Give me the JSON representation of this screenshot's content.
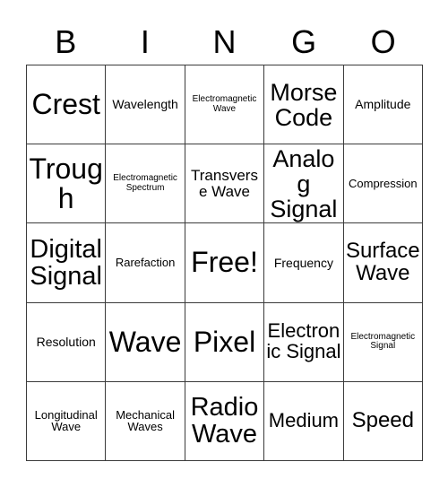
{
  "card": {
    "type": "bingo-card",
    "columns": 5,
    "rows": 5,
    "header": {
      "letters": [
        "B",
        "I",
        "N",
        "G",
        "O"
      ]
    },
    "colors": {
      "background": "#ffffff",
      "border": "#3b3b3b",
      "text": "#000000"
    },
    "cells": [
      {
        "label": "Crest",
        "size": "fs-xxl",
        "free": false
      },
      {
        "label": "Wavelength",
        "size": "fs-xxs",
        "free": false
      },
      {
        "label": "Electromagnetic Wave",
        "size": "fs-mini",
        "free": false
      },
      {
        "label": "Morse Code",
        "size": "fs-lg",
        "free": false
      },
      {
        "label": "Amplitude",
        "size": "fs-xxs",
        "free": false
      },
      {
        "label": "Trough",
        "size": "fs-xxl",
        "free": false
      },
      {
        "label": "Electromagnetic Spectrum",
        "size": "fs-mini",
        "free": false
      },
      {
        "label": "Transverse Wave",
        "size": "fs-xs",
        "free": false
      },
      {
        "label": "Analog Signal",
        "size": "fs-lg",
        "free": false
      },
      {
        "label": "Compression",
        "size": "fs-tiny",
        "free": false
      },
      {
        "label": "Digital Signal",
        "size": "fs-xl",
        "free": false
      },
      {
        "label": "Rarefaction",
        "size": "fs-tiny",
        "free": false
      },
      {
        "label": "Free!",
        "size": "fs-xxl",
        "free": true
      },
      {
        "label": "Frequency",
        "size": "fs-xxs",
        "free": false
      },
      {
        "label": "Surface Wave",
        "size": "fs-md",
        "free": false
      },
      {
        "label": "Resolution",
        "size": "fs-xxs",
        "free": false
      },
      {
        "label": "Wave",
        "size": "fs-xxl",
        "free": false
      },
      {
        "label": "Pixel",
        "size": "fs-xxl",
        "free": false
      },
      {
        "label": "Electronic Signal",
        "size": "fs-sm",
        "free": false
      },
      {
        "label": "Electromagnetic Signal",
        "size": "fs-mini",
        "free": false
      },
      {
        "label": "Longitudinal Wave",
        "size": "fs-tiny",
        "free": false
      },
      {
        "label": "Mechanical Waves",
        "size": "fs-tiny",
        "free": false
      },
      {
        "label": "Radio Wave",
        "size": "fs-xl",
        "free": false
      },
      {
        "label": "Medium",
        "size": "fs-sm",
        "free": false
      },
      {
        "label": "Speed",
        "size": "fs-md",
        "free": false
      }
    ]
  }
}
